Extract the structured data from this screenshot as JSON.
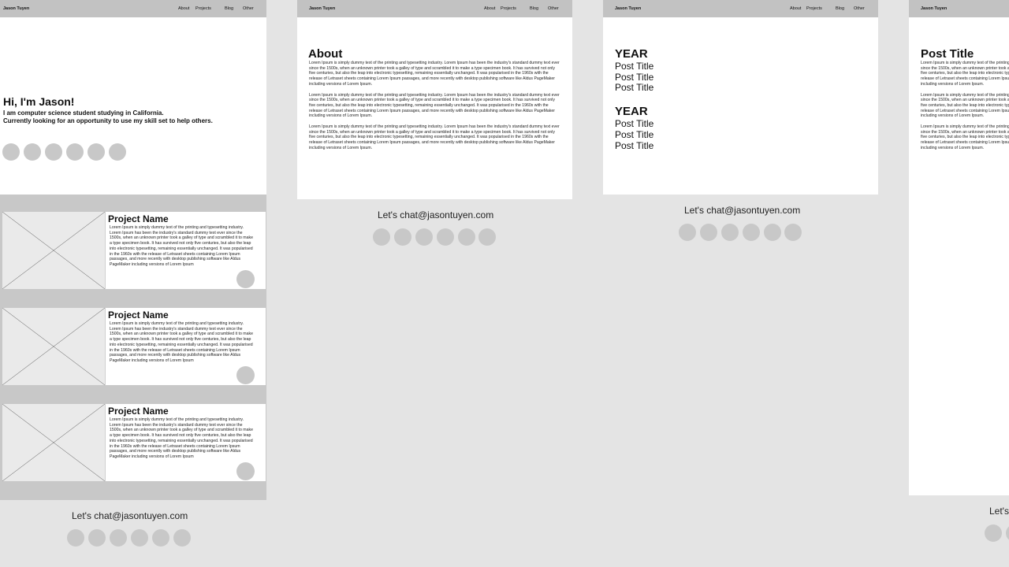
{
  "nav": {
    "brand": "Jason Tuyen",
    "links": [
      "About",
      "Projects",
      "Blog",
      "Other"
    ]
  },
  "home": {
    "greeting": "Hi, I'm Jason!",
    "tagline_1": "I am computer science student studying in California.",
    "tagline_2": "Currently looking for an opportunity to use my skill set to help others.",
    "projects": [
      {
        "name": "Project Name",
        "description": "Lorem Ipsum is simply dummy text of the printing and typesetting industry. Lorem Ipsum has been the industry's standard dummy text ever since the 1500s, when an unknown printer took a galley of type and scrambled it to make a type specimen book. It has survived not only five centuries, but also the leap into electronic typesetting, remaining essentially unchanged. It was popularised in the 1960s with the release of Letraset sheets containing Lorem Ipsum passages, and more recently with desktop publishing software like Aldus PageMaker including versions of Lorem Ipsum"
      },
      {
        "name": "Project Name",
        "description": "Lorem Ipsum is simply dummy text of the printing and typesetting industry. Lorem Ipsum has been the industry's standard dummy text ever since the 1500s, when an unknown printer took a galley of type and scrambled it to make a type specimen book. It has survived not only five centuries, but also the leap into electronic typesetting, remaining essentially unchanged. It was popularised in the 1960s with the release of Letraset sheets containing Lorem Ipsum passages, and more recently with desktop publishing software like Aldus PageMaker including versions of Lorem Ipsum"
      },
      {
        "name": "Project Name",
        "description": "Lorem Ipsum is simply dummy text of the printing and typesetting industry. Lorem Ipsum has been the industry's standard dummy text ever since the 1500s, when an unknown printer took a galley of type and scrambled it to make a type specimen book. It has survived not only five centuries, but also the leap into electronic typesetting, remaining essentially unchanged. It was popularised in the 1960s with the release of Letraset sheets containing Lorem Ipsum passages, and more recently with desktop publishing software like Aldus PageMaker including versions of Lorem Ipsum"
      }
    ]
  },
  "about": {
    "heading": "About",
    "paragraphs": [
      "Lorem Ipsum is simply dummy text of the printing and typesetting industry. Lorem Ipsum has been the industry's standard dummy text ever since the 1500s, when an unknown printer took a galley of type and scrambled it to make a type specimen book. It has survived not only five centuries, but also the leap into electronic typesetting, remaining essentially unchanged. It was popularised in the 1960s with the release of Letraset sheets containing Lorem Ipsum passages, and more recently with desktop publishing software like Aldus PageMaker including versions of Lorem Ipsum.",
      "Lorem Ipsum is simply dummy text of the printing and typesetting industry. Lorem Ipsum has been the industry's standard dummy text ever since the 1500s, when an unknown printer took a galley of type and scrambled it to make a type specimen book. It has survived not only five centuries, but also the leap into electronic typesetting, remaining essentially unchanged. It was popularised in the 1960s with the release of Letraset sheets containing Lorem Ipsum passages, and more recently with desktop publishing software like Aldus PageMaker including versions of Lorem Ipsum.",
      "Lorem Ipsum is simply dummy text of the printing and typesetting industry. Lorem Ipsum has been the industry's standard dummy text ever since the 1500s, when an unknown printer took a galley of type and scrambled it to make a type specimen book. It has survived not only five centuries, but also the leap into electronic typesetting, remaining essentially unchanged. It was popularised in the 1960s with the release of Letraset sheets containing Lorem Ipsum passages, and more recently with desktop publishing software like Aldus PageMaker including versions of Lorem Ipsum."
    ]
  },
  "blog": {
    "groups": [
      {
        "year": "YEAR",
        "posts": [
          "Post Title",
          "Post Title",
          "Post Title"
        ]
      },
      {
        "year": "YEAR",
        "posts": [
          "Post Title",
          "Post Title",
          "Post Title"
        ]
      }
    ]
  },
  "post": {
    "title": "Post Title",
    "paragraphs": [
      "Lorem Ipsum is simply dummy text of the printing and typesetting industry. Lorem Ipsum has been the industry's standard dummy text ever since the 1500s, when an unknown printer took a galley of type and scrambled it to make a type specimen book. It has survived not only five centuries, but also the leap into electronic typesetting, remaining essentially unchanged. It was popularised in the 1960s with the release of Letraset sheets containing Lorem Ipsum passages, and more recently with desktop publishing software like Aldus PageMaker including versions of Lorem Ipsum.",
      "Lorem Ipsum is simply dummy text of the printing and typesetting industry. Lorem Ipsum has been the industry's standard dummy text ever since the 1500s, when an unknown printer took a galley of type and scrambled it to make a type specimen book. It has survived not only five centuries, but also the leap into electronic typesetting, remaining essentially unchanged. It was popularised in the 1960s with the release of Letraset sheets containing Lorem Ipsum passages, and more recently with desktop publishing software like Aldus PageMaker including versions of Lorem Ipsum.",
      "Lorem Ipsum is simply dummy text of the printing and typesetting industry. Lorem Ipsum has been the industry's standard dummy text ever since the 1500s, when an unknown printer took a galley of type and scrambled it to make a type specimen book. It has survived not only five centuries, but also the leap into electronic typesetting, remaining essentially unchanged. It was popularised in the 1960s with the release of Letraset sheets containing Lorem Ipsum passages, and more recently with desktop publishing software like Aldus PageMaker including versions of Lorem Ipsum."
    ]
  },
  "footer": {
    "contact": "Let's chat@jasontuyen.com"
  }
}
